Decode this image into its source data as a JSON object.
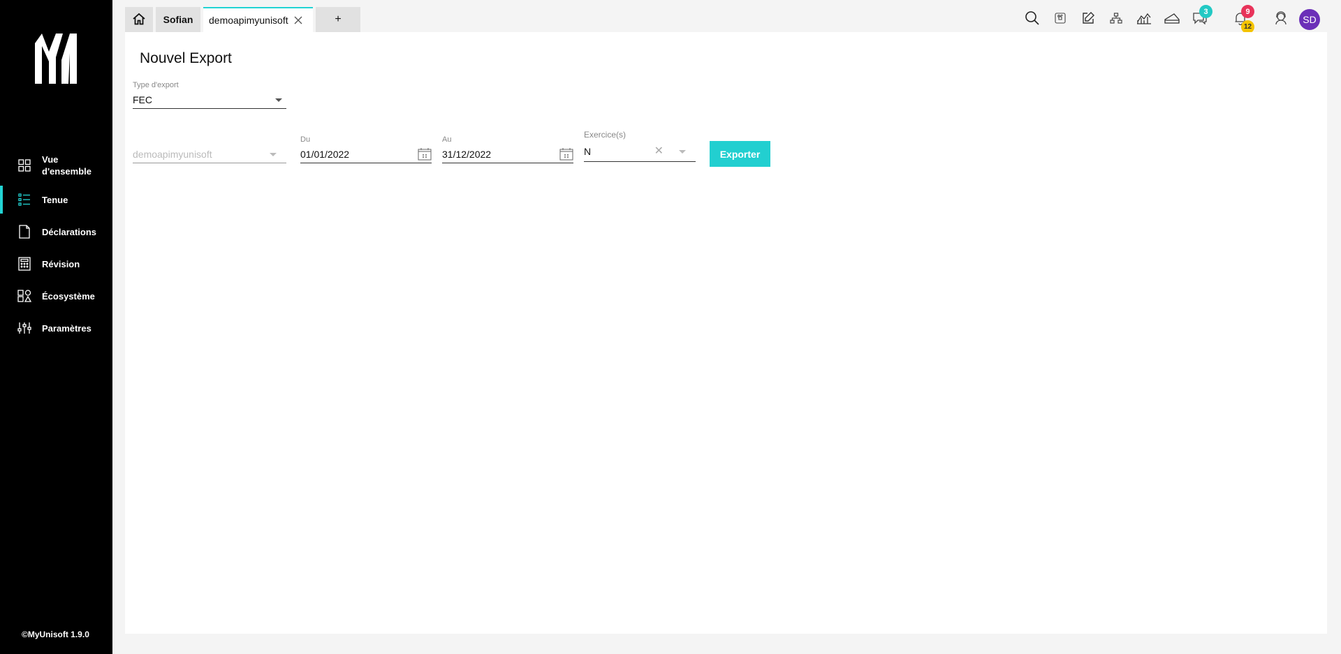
{
  "sidebar": {
    "brand": "MyUnisoft",
    "items": [
      {
        "label": "Vue d'ensemble",
        "icon": "grid-icon",
        "active": false
      },
      {
        "label": "Tenue",
        "icon": "list-icon",
        "active": true
      },
      {
        "label": "Déclarations",
        "icon": "document-icon",
        "active": false
      },
      {
        "label": "Révision",
        "icon": "calculator-icon",
        "active": false
      },
      {
        "label": "Écosystème",
        "icon": "ecosystem-icon",
        "active": false
      },
      {
        "label": "Paramètres",
        "icon": "sliders-icon",
        "active": false
      }
    ],
    "version": "©MyUnisoft 1.9.0"
  },
  "tabs": {
    "home_icon": "home-icon",
    "user": "Sofian",
    "current": "demoapimyunisoft",
    "add": "+"
  },
  "toolbar": {
    "icons": [
      "search-icon",
      "command-icon",
      "edit-icon",
      "network-icon",
      "chart-icon",
      "scanner-icon",
      "chat-icon",
      "bell-icon",
      "support-icon"
    ],
    "chat_badge": "3",
    "bell_badge_red": "9",
    "bell_badge_yellow": "12",
    "avatar_initials": "SD"
  },
  "page": {
    "title": "Nouvel Export",
    "type_label": "Type d'export",
    "type_value": "FEC",
    "dossier_value": "demoapimyunisoft",
    "from_label": "Du",
    "from_value": "01/01/2022",
    "to_label": "Au",
    "to_value": "31/12/2022",
    "exercise_label": "Exercice(s)",
    "exercise_value": "N",
    "export_button": "Exporter"
  },
  "colors": {
    "accent": "#22cfd0",
    "sidebar_bg": "#000000",
    "avatar_bg": "#6b2fb8",
    "badge_red": "#e8335a",
    "badge_yellow": "#f5c400",
    "badge_teal": "#22c9c4"
  }
}
